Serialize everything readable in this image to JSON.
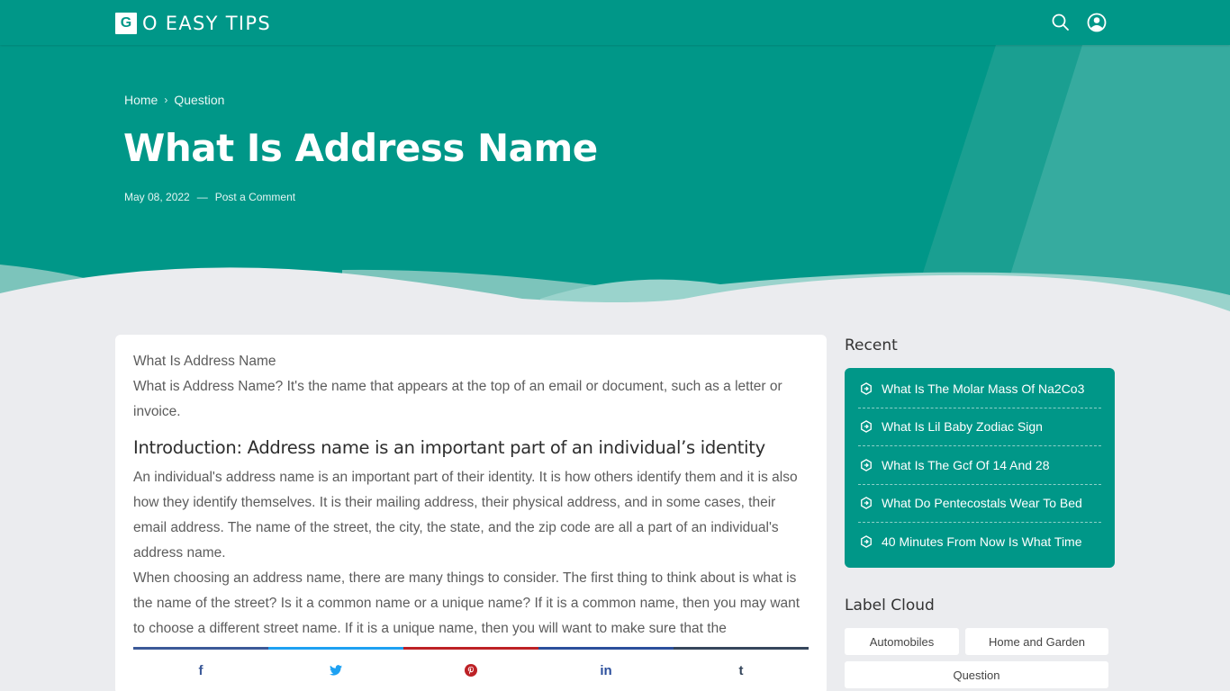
{
  "header": {
    "logo_letter": "G",
    "logo_text": "O EASY TIPS",
    "icons": [
      "search-icon",
      "user-account-icon"
    ]
  },
  "hero": {
    "breadcrumb": [
      {
        "label": "Home"
      },
      {
        "label": "Question"
      }
    ],
    "breadcrumb_separator": "›",
    "title": "What Is Address Name",
    "date": "May 08, 2022",
    "meta_separator": "—",
    "comment_link": "Post a Comment"
  },
  "article": {
    "lead_title": "What Is Address Name",
    "intro": "What is Address Name? It's the name that appears at the top of an email or document, such as a letter or invoice.",
    "heading": "Introduction: Address name is an important part of an individual’s identity",
    "paragraph1": "An individual's address name is an important part of their identity. It is how others identify them and it is also how they identify themselves. It is their mailing address, their physical address, and in some cases, their email address. The name of the street, the city, the state, and the zip code are all a part of an individual's address name.",
    "paragraph2": "When choosing an address name, there are many things to consider. The first thing to think about is what is the name of the street? Is it a common name or a unique name? If it is a common name, then you may want to choose a different street name. If it is a unique name, then you will want to make sure that the"
  },
  "share": [
    {
      "network": "facebook",
      "icon": "facebook-icon",
      "glyph": "f",
      "color": "#3b5998"
    },
    {
      "network": "twitter",
      "icon": "twitter-icon",
      "glyph": "",
      "color": "#1da1f2"
    },
    {
      "network": "pinterest",
      "icon": "pinterest-icon",
      "glyph": "",
      "color": "#bd2126"
    },
    {
      "network": "linkedin",
      "icon": "linkedin-icon",
      "glyph": "in",
      "color": "#2b4f9c"
    },
    {
      "network": "tumblr",
      "icon": "tumblr-icon",
      "glyph": "t",
      "color": "#35465c"
    }
  ],
  "sidebar": {
    "recent_title": "Recent",
    "recent": [
      {
        "label": "What Is The Molar Mass Of Na2Co3"
      },
      {
        "label": "What Is Lil Baby Zodiac Sign"
      },
      {
        "label": "What Is The Gcf Of 14 And 28"
      },
      {
        "label": "What Do Pentecostals Wear To Bed"
      },
      {
        "label": "40 Minutes From Now Is What Time"
      }
    ],
    "labels_title": "Label Cloud",
    "labels": [
      {
        "label": "Automobiles"
      },
      {
        "label": "Home and Garden"
      },
      {
        "label": "Question"
      }
    ]
  },
  "colors": {
    "brand": "#009788",
    "page_bg": "#ebecef"
  }
}
